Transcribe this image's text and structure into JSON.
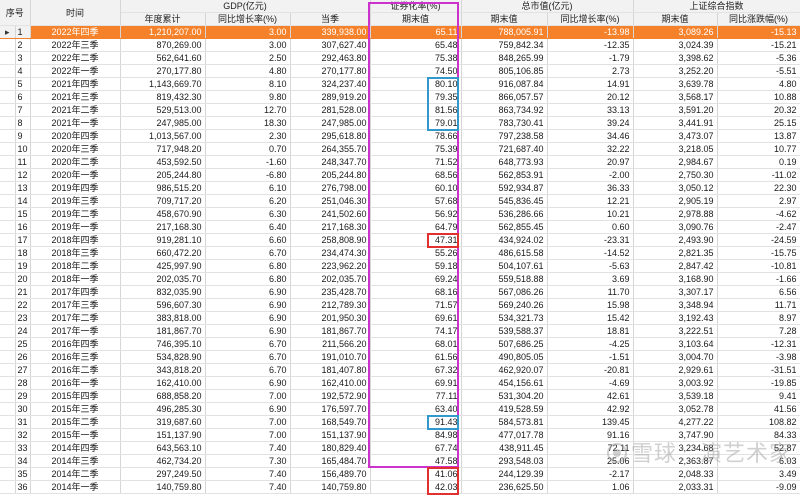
{
  "header": {
    "group_gdp": "GDP(亿元)",
    "group_sec": "证券化率(%)",
    "group_mcap": "总市值(亿元)",
    "group_index": "上证综合指数",
    "col_idx": "序号",
    "col_time": "时间",
    "col_gdp_cum": "年度累计",
    "col_gdp_yoy": "同比增长率(%)",
    "col_gdp_q": "当季",
    "col_sec_end": "期末值",
    "col_mcap_end": "期末值",
    "col_mcap_yoy": "同比增长率(%)",
    "col_idx_end": "期末值",
    "col_idx_chg": "同比涨跌幅(%)"
  },
  "selected_marker": "▸",
  "rows": [
    {
      "idx": "1",
      "time": "2022年四季",
      "gdp_cum": "1,210,207.00",
      "gdp_yoy": "3.00",
      "gdp_q": "339,938.00",
      "sec": "65.11",
      "mcap": "788,005.91",
      "mcap_yoy": "-13.98",
      "idx_end": "3,089.26",
      "idx_chg": "-15.13"
    },
    {
      "idx": "2",
      "time": "2022年三季",
      "gdp_cum": "870,269.00",
      "gdp_yoy": "3.00",
      "gdp_q": "307,627.40",
      "sec": "65.48",
      "mcap": "759,842.34",
      "mcap_yoy": "-12.35",
      "idx_end": "3,024.39",
      "idx_chg": "-15.21"
    },
    {
      "idx": "3",
      "time": "2022年二季",
      "gdp_cum": "562,641.60",
      "gdp_yoy": "2.50",
      "gdp_q": "292,463.80",
      "sec": "75.38",
      "mcap": "848,265.99",
      "mcap_yoy": "-1.79",
      "idx_end": "3,398.62",
      "idx_chg": "-5.36"
    },
    {
      "idx": "4",
      "time": "2022年一季",
      "gdp_cum": "270,177.80",
      "gdp_yoy": "4.80",
      "gdp_q": "270,177.80",
      "sec": "74.50",
      "mcap": "805,106.85",
      "mcap_yoy": "2.73",
      "idx_end": "3,252.20",
      "idx_chg": "-5.51"
    },
    {
      "idx": "5",
      "time": "2021年四季",
      "gdp_cum": "1,143,669.70",
      "gdp_yoy": "8.10",
      "gdp_q": "324,237.40",
      "sec": "80.10",
      "mcap": "916,087.84",
      "mcap_yoy": "14.91",
      "idx_end": "3,639.78",
      "idx_chg": "4.80"
    },
    {
      "idx": "6",
      "time": "2021年三季",
      "gdp_cum": "819,432.30",
      "gdp_yoy": "9.80",
      "gdp_q": "289,919.20",
      "sec": "79.35",
      "mcap": "866,057.57",
      "mcap_yoy": "20.12",
      "idx_end": "3,568.17",
      "idx_chg": "10.88"
    },
    {
      "idx": "7",
      "time": "2021年二季",
      "gdp_cum": "529,513.00",
      "gdp_yoy": "12.70",
      "gdp_q": "281,528.00",
      "sec": "81.56",
      "mcap": "863,734.92",
      "mcap_yoy": "33.13",
      "idx_end": "3,591.20",
      "idx_chg": "20.32"
    },
    {
      "idx": "8",
      "time": "2021年一季",
      "gdp_cum": "247,985.00",
      "gdp_yoy": "18.30",
      "gdp_q": "247,985.00",
      "sec": "79.01",
      "mcap": "783,730.41",
      "mcap_yoy": "39.24",
      "idx_end": "3,441.91",
      "idx_chg": "25.15"
    },
    {
      "idx": "9",
      "time": "2020年四季",
      "gdp_cum": "1,013,567.00",
      "gdp_yoy": "2.30",
      "gdp_q": "295,618.80",
      "sec": "78.66",
      "mcap": "797,238.58",
      "mcap_yoy": "34.46",
      "idx_end": "3,473.07",
      "idx_chg": "13.87"
    },
    {
      "idx": "10",
      "time": "2020年三季",
      "gdp_cum": "717,948.20",
      "gdp_yoy": "0.70",
      "gdp_q": "264,355.70",
      "sec": "75.39",
      "mcap": "721,687.40",
      "mcap_yoy": "32.22",
      "idx_end": "3,218.05",
      "idx_chg": "10.77"
    },
    {
      "idx": "11",
      "time": "2020年二季",
      "gdp_cum": "453,592.50",
      "gdp_yoy": "-1.60",
      "gdp_q": "248,347.70",
      "sec": "71.52",
      "mcap": "648,773.93",
      "mcap_yoy": "20.97",
      "idx_end": "2,984.67",
      "idx_chg": "0.19"
    },
    {
      "idx": "12",
      "time": "2020年一季",
      "gdp_cum": "205,244.80",
      "gdp_yoy": "-6.80",
      "gdp_q": "205,244.80",
      "sec": "68.56",
      "mcap": "562,853.91",
      "mcap_yoy": "-2.00",
      "idx_end": "2,750.30",
      "idx_chg": "-11.02"
    },
    {
      "idx": "13",
      "time": "2019年四季",
      "gdp_cum": "986,515.20",
      "gdp_yoy": "6.10",
      "gdp_q": "276,798.00",
      "sec": "60.10",
      "mcap": "592,934.87",
      "mcap_yoy": "36.33",
      "idx_end": "3,050.12",
      "idx_chg": "22.30"
    },
    {
      "idx": "14",
      "time": "2019年三季",
      "gdp_cum": "709,717.20",
      "gdp_yoy": "6.20",
      "gdp_q": "251,046.30",
      "sec": "57.68",
      "mcap": "545,836.45",
      "mcap_yoy": "12.21",
      "idx_end": "2,905.19",
      "idx_chg": "2.97"
    },
    {
      "idx": "15",
      "time": "2019年二季",
      "gdp_cum": "458,670.90",
      "gdp_yoy": "6.30",
      "gdp_q": "241,502.60",
      "sec": "56.92",
      "mcap": "536,286.66",
      "mcap_yoy": "10.21",
      "idx_end": "2,978.88",
      "idx_chg": "-4.62"
    },
    {
      "idx": "16",
      "time": "2019年一季",
      "gdp_cum": "217,168.30",
      "gdp_yoy": "6.40",
      "gdp_q": "217,168.30",
      "sec": "64.79",
      "mcap": "562,855.45",
      "mcap_yoy": "0.60",
      "idx_end": "3,090.76",
      "idx_chg": "-2.47"
    },
    {
      "idx": "17",
      "time": "2018年四季",
      "gdp_cum": "919,281.10",
      "gdp_yoy": "6.60",
      "gdp_q": "258,808.90",
      "sec": "47.31",
      "mcap": "434,924.02",
      "mcap_yoy": "-23.31",
      "idx_end": "2,493.90",
      "idx_chg": "-24.59"
    },
    {
      "idx": "18",
      "time": "2018年三季",
      "gdp_cum": "660,472.20",
      "gdp_yoy": "6.70",
      "gdp_q": "234,474.30",
      "sec": "55.26",
      "mcap": "486,615.58",
      "mcap_yoy": "-14.52",
      "idx_end": "2,821.35",
      "idx_chg": "-15.75"
    },
    {
      "idx": "19",
      "time": "2018年二季",
      "gdp_cum": "425,997.90",
      "gdp_yoy": "6.80",
      "gdp_q": "223,962.20",
      "sec": "59.18",
      "mcap": "504,107.61",
      "mcap_yoy": "-5.63",
      "idx_end": "2,847.42",
      "idx_chg": "-10.81"
    },
    {
      "idx": "20",
      "time": "2018年一季",
      "gdp_cum": "202,035.70",
      "gdp_yoy": "6.80",
      "gdp_q": "202,035.70",
      "sec": "69.24",
      "mcap": "559,518.88",
      "mcap_yoy": "3.69",
      "idx_end": "3,168.90",
      "idx_chg": "-1.66"
    },
    {
      "idx": "21",
      "time": "2017年四季",
      "gdp_cum": "832,035.90",
      "gdp_yoy": "6.90",
      "gdp_q": "235,428.70",
      "sec": "68.16",
      "mcap": "567,086.26",
      "mcap_yoy": "11.70",
      "idx_end": "3,307.17",
      "idx_chg": "6.56"
    },
    {
      "idx": "22",
      "time": "2017年三季",
      "gdp_cum": "596,607.30",
      "gdp_yoy": "6.90",
      "gdp_q": "212,789.30",
      "sec": "71.57",
      "mcap": "569,240.26",
      "mcap_yoy": "15.98",
      "idx_end": "3,348.94",
      "idx_chg": "11.71"
    },
    {
      "idx": "23",
      "time": "2017年二季",
      "gdp_cum": "383,818.00",
      "gdp_yoy": "6.90",
      "gdp_q": "201,950.30",
      "sec": "69.61",
      "mcap": "534,321.73",
      "mcap_yoy": "15.42",
      "idx_end": "3,192.43",
      "idx_chg": "8.97"
    },
    {
      "idx": "24",
      "time": "2017年一季",
      "gdp_cum": "181,867.70",
      "gdp_yoy": "6.90",
      "gdp_q": "181,867.70",
      "sec": "74.17",
      "mcap": "539,588.37",
      "mcap_yoy": "18.81",
      "idx_end": "3,222.51",
      "idx_chg": "7.28"
    },
    {
      "idx": "25",
      "time": "2016年四季",
      "gdp_cum": "746,395.10",
      "gdp_yoy": "6.70",
      "gdp_q": "211,566.20",
      "sec": "68.01",
      "mcap": "507,686.25",
      "mcap_yoy": "-4.25",
      "idx_end": "3,103.64",
      "idx_chg": "-12.31"
    },
    {
      "idx": "26",
      "time": "2016年三季",
      "gdp_cum": "534,828.90",
      "gdp_yoy": "6.70",
      "gdp_q": "191,010.70",
      "sec": "61.56",
      "mcap": "490,805.05",
      "mcap_yoy": "-1.51",
      "idx_end": "3,004.70",
      "idx_chg": "-3.98"
    },
    {
      "idx": "27",
      "time": "2016年二季",
      "gdp_cum": "343,818.20",
      "gdp_yoy": "6.70",
      "gdp_q": "181,407.80",
      "sec": "67.32",
      "mcap": "462,920.07",
      "mcap_yoy": "-20.81",
      "idx_end": "2,929.61",
      "idx_chg": "-31.51"
    },
    {
      "idx": "28",
      "time": "2016年一季",
      "gdp_cum": "162,410.00",
      "gdp_yoy": "6.90",
      "gdp_q": "162,410.00",
      "sec": "69.91",
      "mcap": "454,156.61",
      "mcap_yoy": "-4.69",
      "idx_end": "3,003.92",
      "idx_chg": "-19.85"
    },
    {
      "idx": "29",
      "time": "2015年四季",
      "gdp_cum": "688,858.20",
      "gdp_yoy": "7.00",
      "gdp_q": "192,572.90",
      "sec": "77.11",
      "mcap": "531,304.20",
      "mcap_yoy": "42.61",
      "idx_end": "3,539.18",
      "idx_chg": "9.41"
    },
    {
      "idx": "30",
      "time": "2015年三季",
      "gdp_cum": "496,285.30",
      "gdp_yoy": "6.90",
      "gdp_q": "176,597.70",
      "sec": "63.40",
      "mcap": "419,528.59",
      "mcap_yoy": "42.92",
      "idx_end": "3,052.78",
      "idx_chg": "41.56"
    },
    {
      "idx": "31",
      "time": "2015年二季",
      "gdp_cum": "319,687.60",
      "gdp_yoy": "7.00",
      "gdp_q": "168,549.70",
      "sec": "91.43",
      "mcap": "584,573.81",
      "mcap_yoy": "139.45",
      "idx_end": "4,277.22",
      "idx_chg": "108.82"
    },
    {
      "idx": "32",
      "time": "2015年一季",
      "gdp_cum": "151,137.90",
      "gdp_yoy": "7.00",
      "gdp_q": "151,137.90",
      "sec": "84.98",
      "mcap": "477,017.78",
      "mcap_yoy": "91.16",
      "idx_end": "3,747.90",
      "idx_chg": "84.33"
    },
    {
      "idx": "33",
      "time": "2014年四季",
      "gdp_cum": "643,563.10",
      "gdp_yoy": "7.40",
      "gdp_q": "180,829.40",
      "sec": "67.74",
      "mcap": "438,911.45",
      "mcap_yoy": "72.11",
      "idx_end": "3,234.68",
      "idx_chg": "52.87"
    },
    {
      "idx": "34",
      "time": "2014年三季",
      "gdp_cum": "462,734.20",
      "gdp_yoy": "7.30",
      "gdp_q": "165,484.70",
      "sec": "47.58",
      "mcap": "293,548.03",
      "mcap_yoy": "25.06",
      "idx_end": "2,363.87",
      "idx_chg": "6.03"
    },
    {
      "idx": "35",
      "time": "2014年二季",
      "gdp_cum": "297,249.50",
      "gdp_yoy": "7.40",
      "gdp_q": "156,489.70",
      "sec": "41.06",
      "mcap": "244,129.39",
      "mcap_yoy": "-2.17",
      "idx_end": "2,048.33",
      "idx_chg": "3.49"
    },
    {
      "idx": "36",
      "time": "2014年一季",
      "gdp_cum": "140,759.80",
      "gdp_yoy": "7.40",
      "gdp_q": "140,759.80",
      "sec": "42.03",
      "mcap": "236,625.50",
      "mcap_yoy": "1.06",
      "idx_end": "2,033.31",
      "idx_chg": "-9.09"
    }
  ],
  "watermark": "雪球：演艺术家",
  "colors": {
    "selected_row": "#f5822a",
    "column_frame": "#cc33cc",
    "mark_cyan": "#3399cc",
    "mark_red": "#e03030"
  }
}
